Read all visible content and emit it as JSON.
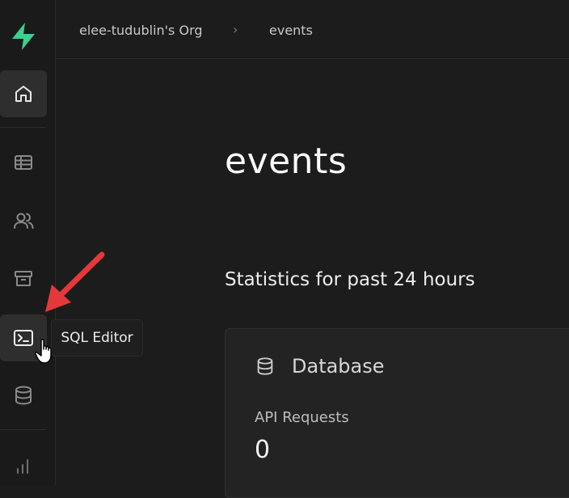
{
  "breadcrumb": {
    "org": "elee-tudublin's Org",
    "separator": "›",
    "project": "events"
  },
  "main": {
    "title": "events",
    "stats_heading": "Statistics for past 24 hours",
    "card": {
      "title": "Database",
      "icon": "database-icon",
      "metric_label": "API Requests",
      "metric_value": "0"
    }
  },
  "sidebar": {
    "items": [
      {
        "icon": "home-icon",
        "active": true
      },
      {
        "icon": "table-editor-icon"
      },
      {
        "icon": "users-icon"
      },
      {
        "icon": "storage-archive-icon"
      },
      {
        "icon": "sql-editor-terminal-icon",
        "active": true
      },
      {
        "icon": "database-icon"
      },
      {
        "icon": "reports-bar-chart-icon"
      }
    ]
  },
  "tooltip": {
    "label": "SQL Editor"
  },
  "colors": {
    "brand": "#3ecf8e",
    "background": "#1c1c1c",
    "annotation_arrow": "#e5383b"
  }
}
